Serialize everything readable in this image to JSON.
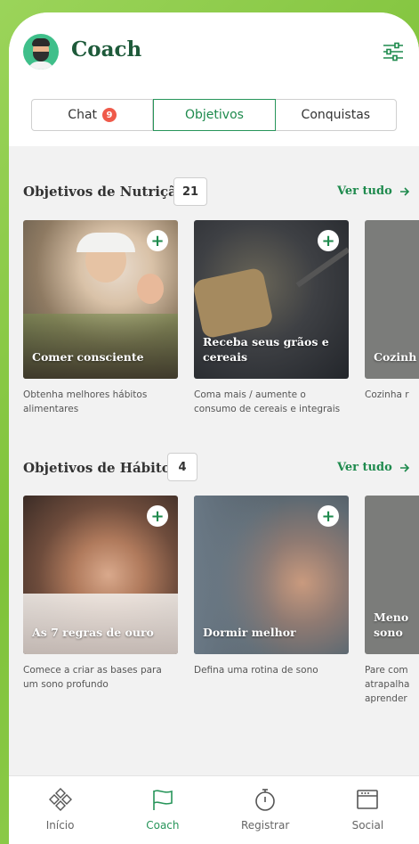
{
  "header": {
    "title": "Coach"
  },
  "tabs": [
    {
      "label": "Chat",
      "badge": "9"
    },
    {
      "label": "Objetivos"
    },
    {
      "label": "Conquistas"
    }
  ],
  "nutrition": {
    "title": "Objetivos de Nutrição",
    "count": "21",
    "see_all": "Ver tudo",
    "cards": [
      {
        "title": "Comer consciente",
        "description": "Obtenha melhores hábitos alimentares"
      },
      {
        "title": "Receba seus grãos e cereais",
        "description": "Coma mais / aumente o consumo de cereais e integrais"
      },
      {
        "title": "Cozinh",
        "description": "Cozinha r"
      }
    ]
  },
  "habits": {
    "title": "Objetivos de Hábitos",
    "count": "4",
    "see_all": "Ver tudo",
    "cards": [
      {
        "title": "As 7 regras de ouro",
        "description": "Comece a criar as bases para um sono profundo"
      },
      {
        "title": "Dormir melhor",
        "description": "Defina uma rotina de sono"
      },
      {
        "title": "Meno sono",
        "description": "Pare com atrapalha aprender"
      }
    ]
  },
  "nav": [
    {
      "label": "Início",
      "icon": "home-icon"
    },
    {
      "label": "Coach",
      "icon": "flag-icon"
    },
    {
      "label": "Registrar",
      "icon": "stopwatch-icon"
    },
    {
      "label": "Social",
      "icon": "social-icon"
    }
  ],
  "colors": {
    "accent": "#1e8a4d",
    "badge": "#ef5a4a",
    "background": "#f2f2f2"
  }
}
